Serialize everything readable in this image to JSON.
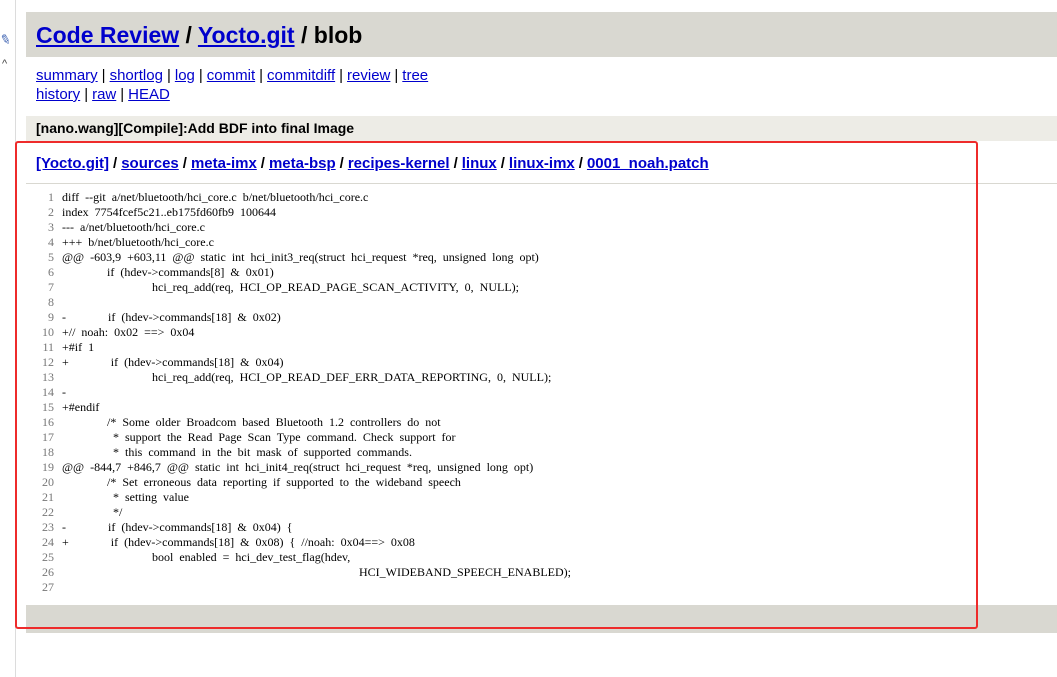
{
  "header": {
    "project": "Code Review",
    "repo": "Yocto.git",
    "action": "blob"
  },
  "nav": {
    "row1": [
      "summary",
      "shortlog",
      "log",
      "commit",
      "commitdiff",
      "review",
      "tree"
    ],
    "row2": [
      "history",
      "raw",
      "HEAD"
    ]
  },
  "commit_title": "[nano.wang][Compile]:Add BDF into final Image",
  "path": [
    "[Yocto.git]",
    "sources",
    "meta-imx",
    "meta-bsp",
    "recipes-kernel",
    "linux",
    "linux-imx",
    "0001_noah.patch"
  ],
  "code_lines": [
    {
      "n": "1",
      "text": "diff  --git  a/net/bluetooth/hci_core.c  b/net/bluetooth/hci_core.c"
    },
    {
      "n": "2",
      "text": "index  7754fcef5c21..eb175fd60fb9  100644"
    },
    {
      "n": "3",
      "text": "---  a/net/bluetooth/hci_core.c"
    },
    {
      "n": "4",
      "text": "+++  b/net/bluetooth/hci_core.c"
    },
    {
      "n": "5",
      "text": "@@  -603,9  +603,11  @@  static  int  hci_init3_req(struct  hci_request  *req,  unsigned  long  opt)"
    },
    {
      "n": "6",
      "text": "               if  (hdev->commands[8]  &  0x01)"
    },
    {
      "n": "7",
      "text": "                              hci_req_add(req,  HCI_OP_READ_PAGE_SCAN_ACTIVITY,  0,  NULL);"
    },
    {
      "n": "8",
      "text": ""
    },
    {
      "n": "9",
      "text": "-              if  (hdev->commands[18]  &  0x02)"
    },
    {
      "n": "10",
      "text": "+//  noah:  0x02  ==>  0x04"
    },
    {
      "n": "11",
      "text": "+#if  1"
    },
    {
      "n": "12",
      "text": "+              if  (hdev->commands[18]  &  0x04)"
    },
    {
      "n": "13",
      "text": "                              hci_req_add(req,  HCI_OP_READ_DEF_ERR_DATA_REPORTING,  0,  NULL);"
    },
    {
      "n": "14",
      "text": "-"
    },
    {
      "n": "15",
      "text": "+#endif"
    },
    {
      "n": "16",
      "text": "               /*  Some  older  Broadcom  based  Bluetooth  1.2  controllers  do  not"
    },
    {
      "n": "17",
      "text": "                 *  support  the  Read  Page  Scan  Type  command.  Check  support  for"
    },
    {
      "n": "18",
      "text": "                 *  this  command  in  the  bit  mask  of  supported  commands."
    },
    {
      "n": "19",
      "text": "@@  -844,7  +846,7  @@  static  int  hci_init4_req(struct  hci_request  *req,  unsigned  long  opt)"
    },
    {
      "n": "20",
      "text": "               /*  Set  erroneous  data  reporting  if  supported  to  the  wideband  speech"
    },
    {
      "n": "21",
      "text": "                 *  setting  value"
    },
    {
      "n": "22",
      "text": "                 */"
    },
    {
      "n": "23",
      "text": "-              if  (hdev->commands[18]  &  0x04)  {"
    },
    {
      "n": "24",
      "text": "+              if  (hdev->commands[18]  &  0x08)  {  //noah:  0x04==>  0x08"
    },
    {
      "n": "25",
      "text": "                              bool  enabled  =  hci_dev_test_flag(hdev,"
    },
    {
      "n": "26",
      "text": "                                                                                                   HCI_WIDEBAND_SPEECH_ENABLED);"
    },
    {
      "n": "27",
      "text": ""
    }
  ],
  "colors": {
    "header_bg": "#d9d8d1",
    "link": "#0000cc",
    "highlight_border": "#ee2b2b"
  },
  "icons": [
    "pen-icon",
    "chevron-up-icon"
  ]
}
